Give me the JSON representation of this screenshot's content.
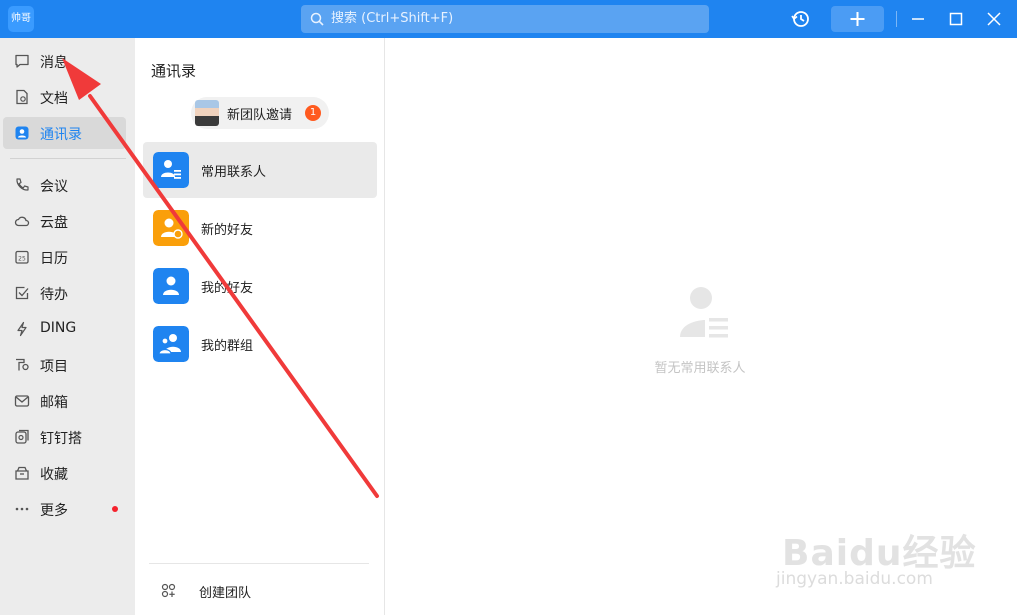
{
  "app": {
    "avatar_text": "帅哥",
    "search_placeholder": "搜索 (Ctrl+Shift+F)",
    "accent": "#1f84f0"
  },
  "titlebar": {
    "icons": [
      "history-icon",
      "plus-icon",
      "minimize-icon",
      "maximize-icon",
      "close-icon"
    ]
  },
  "sidebar": {
    "items": [
      {
        "label": "消息",
        "icon": "chat-bubble-icon"
      },
      {
        "label": "文档",
        "icon": "document-icon"
      },
      {
        "label": "通讯录",
        "icon": "contacts-icon",
        "active": true
      },
      {
        "label": "会议",
        "icon": "phone-icon"
      },
      {
        "label": "云盘",
        "icon": "cloud-icon"
      },
      {
        "label": "日历",
        "icon": "calendar-icon"
      },
      {
        "label": "待办",
        "icon": "checkbox-icon"
      },
      {
        "label": "DING",
        "icon": "lightning-icon"
      },
      {
        "label": "项目",
        "icon": "project-icon"
      },
      {
        "label": "邮箱",
        "icon": "mail-icon"
      },
      {
        "label": "钉钉搭",
        "icon": "build-icon"
      },
      {
        "label": "收藏",
        "icon": "favorites-icon"
      },
      {
        "label": "更多",
        "icon": "more-icon",
        "has_dot": true
      }
    ]
  },
  "contacts": {
    "title": "通讯录",
    "invite": {
      "label": "新团队邀请",
      "badge": "1"
    },
    "rows": [
      {
        "label": "常用联系人",
        "color": "#1f84f0",
        "active": true
      },
      {
        "label": "新的好友",
        "color": "#fa9f0a"
      },
      {
        "label": "我的好友",
        "color": "#1f84f0"
      },
      {
        "label": "我的群组",
        "color": "#1f84f0"
      }
    ],
    "create_team": "创建团队"
  },
  "main": {
    "empty_text": "暂无常用联系人"
  },
  "watermark": {
    "logo": "Baidu经验",
    "url": "jingyan.baidu.com"
  }
}
